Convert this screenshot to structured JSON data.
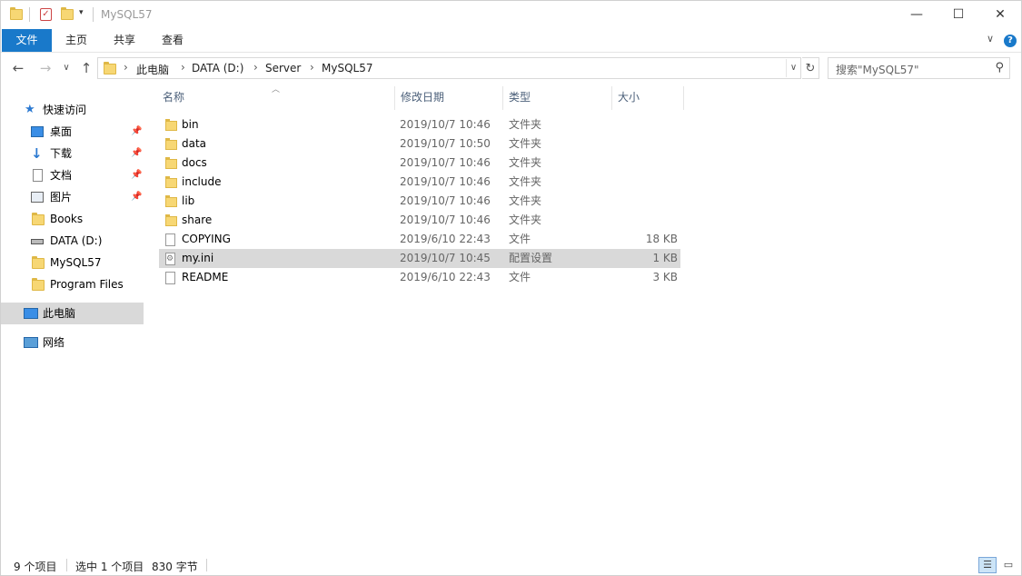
{
  "window": {
    "title": "MySQL57",
    "minimize": "—",
    "maximize": "☐",
    "close": "✕"
  },
  "ribbon": {
    "tabs": [
      "文件",
      "主页",
      "共享",
      "查看"
    ],
    "expand": "∨",
    "help": "?"
  },
  "nav": {
    "back": "←",
    "forward": "→",
    "recent": "∨",
    "up": "↑",
    "breadcrumb": [
      "此电脑",
      "DATA (D:)",
      "Server",
      "MySQL57"
    ],
    "search_placeholder": "搜索\"MySQL57\""
  },
  "sidebar": {
    "items": [
      {
        "label": "快速访问",
        "icon": "star-icon"
      },
      {
        "label": "桌面",
        "icon": "desktop-icon",
        "pinned": true
      },
      {
        "label": "下载",
        "icon": "download-icon",
        "pinned": true
      },
      {
        "label": "文档",
        "icon": "document-icon",
        "pinned": true
      },
      {
        "label": "图片",
        "icon": "pictures-icon",
        "pinned": true
      },
      {
        "label": "Books",
        "icon": "folder-icon"
      },
      {
        "label": "DATA (D:)",
        "icon": "drive-icon"
      },
      {
        "label": "MySQL57",
        "icon": "folder-icon"
      },
      {
        "label": "Program Files",
        "icon": "folder-icon"
      },
      {
        "label": "此电脑",
        "icon": "computer-icon",
        "selected": true
      },
      {
        "label": "网络",
        "icon": "network-icon"
      }
    ]
  },
  "columns": {
    "name": "名称",
    "date": "修改日期",
    "type": "类型",
    "size": "大小"
  },
  "files": [
    {
      "name": "bin",
      "date": "2019/10/7 10:46",
      "type": "文件夹",
      "size": "",
      "kind": "folder"
    },
    {
      "name": "data",
      "date": "2019/10/7 10:50",
      "type": "文件夹",
      "size": "",
      "kind": "folder"
    },
    {
      "name": "docs",
      "date": "2019/10/7 10:46",
      "type": "文件夹",
      "size": "",
      "kind": "folder"
    },
    {
      "name": "include",
      "date": "2019/10/7 10:46",
      "type": "文件夹",
      "size": "",
      "kind": "folder"
    },
    {
      "name": "lib",
      "date": "2019/10/7 10:46",
      "type": "文件夹",
      "size": "",
      "kind": "folder"
    },
    {
      "name": "share",
      "date": "2019/10/7 10:46",
      "type": "文件夹",
      "size": "",
      "kind": "folder"
    },
    {
      "name": "COPYING",
      "date": "2019/6/10 22:43",
      "type": "文件",
      "size": "18 KB",
      "kind": "file"
    },
    {
      "name": "my.ini",
      "date": "2019/10/7 10:45",
      "type": "配置设置",
      "size": "1 KB",
      "kind": "ini",
      "selected": true
    },
    {
      "name": "README",
      "date": "2019/6/10 22:43",
      "type": "文件",
      "size": "3 KB",
      "kind": "file"
    }
  ],
  "status": {
    "count": "9 个项目",
    "selected": "选中 1 个项目",
    "size": "830 字节"
  },
  "colors": {
    "accent": "#1979ca",
    "selection": "#d9d9d9",
    "folder": "#f7d774"
  }
}
